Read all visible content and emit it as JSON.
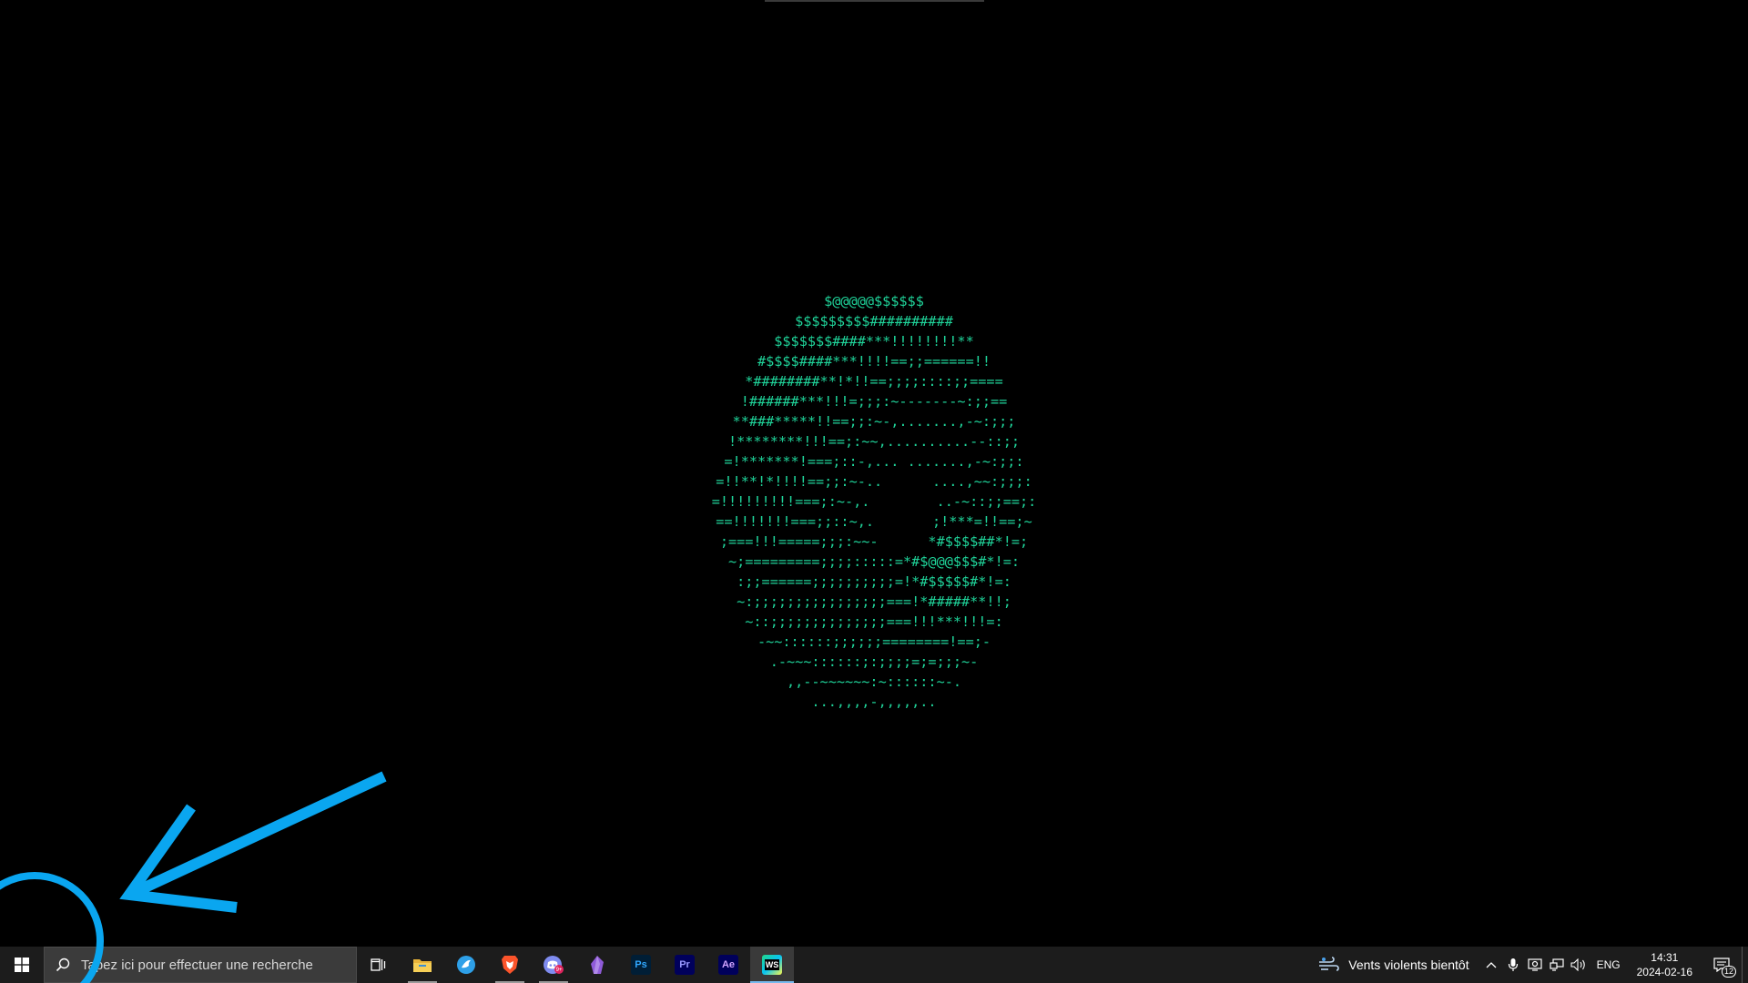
{
  "desktop": {
    "ascii_art": [
      "$@@@@@$$$$$$",
      "$$$$$$$$$##########",
      "$$$$$$$####***!!!!!!!!**",
      "#$$$$####***!!!!==;;======!!",
      "*########**!*!!==;;;;::::;;====",
      "!######***!!!=;;;:~-------~:;;==",
      "**###*****!!==;;:~-,.......,-~:;;;",
      "!********!!!==;:~~,..........--::;;",
      "=!*******!===;::-,... .......,-~:;;:",
      "=!!**!*!!!!==;;:~-..      ....,~~:;;;:",
      "=!!!!!!!!!===;:~-,.        ..-~::;;==;:",
      "==!!!!!!!===;;::~,.       ;!***=!!==;~",
      ";===!!!=====;;;:~~-      *#$$$$##*!=;",
      "~;=========;;;;:::::=*#$@@@$$$#*!=:",
      ":;;======;;;;;;;;;;=!*#$$$$$#*!=:",
      "~:;;;;;;;;;;;;;;;;===!*#####**!!;",
      "~::;;;;;;;;;;;;;;===!!!***!!!=:",
      "-~~::::::;;;;;;========!==;-",
      ".-~~~::::::;:;;;;=;=;;;~-",
      ",,--~~~~~~:~::::::~-.",
      "...,,,,-,,,,,.."
    ]
  },
  "taskbar": {
    "start_icon": "windows-logo-icon",
    "search": {
      "placeholder": "Tapez ici pour effectuer une recherche"
    },
    "apps": [
      {
        "name": "task-view",
        "icon": "task-view-icon"
      },
      {
        "name": "file-explorer",
        "icon": "folder-icon",
        "running": true
      },
      {
        "name": "app-blue-bird",
        "icon": "bird-icon"
      },
      {
        "name": "brave",
        "icon": "brave-lion-icon",
        "running": true
      },
      {
        "name": "discord",
        "icon": "discord-icon",
        "badge": "9+",
        "running": true
      },
      {
        "name": "obsidian",
        "icon": "obsidian-crystal-icon"
      },
      {
        "name": "photoshop",
        "label": "Ps"
      },
      {
        "name": "premiere-pro",
        "label": "Pr"
      },
      {
        "name": "after-effects",
        "label": "Ae"
      },
      {
        "name": "webstorm",
        "label": "WS",
        "active": true
      }
    ],
    "weather": {
      "text": "Vents violents bientôt",
      "icon": "wind-icon"
    },
    "tray": {
      "language": "ENG",
      "time": "14:31",
      "date": "2024-02-16",
      "notification_count": "12"
    }
  },
  "colors": {
    "ascii_green": "#1fd49a",
    "annotation_blue": "#0aa6f0",
    "taskbar_bg": "#1c1c1c",
    "search_bg": "#3b3b3b"
  }
}
